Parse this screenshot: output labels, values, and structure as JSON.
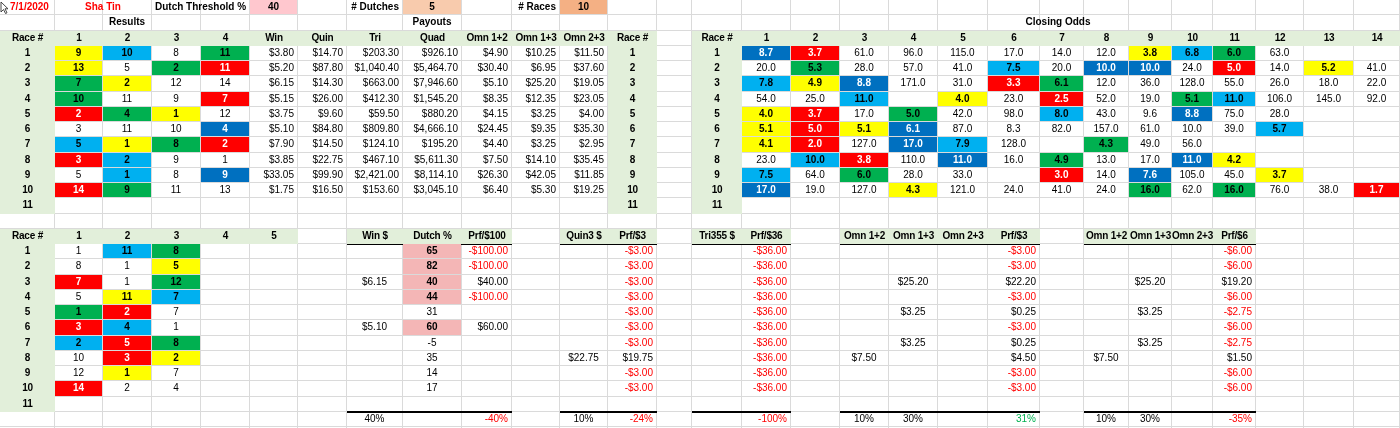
{
  "sheet": {
    "date": "7/1/2020",
    "track": "Sha Tin",
    "settings": [
      {
        "label": "Dutch Threshold %",
        "value": "40",
        "color": "#ffc7ce"
      },
      {
        "label": "# Dutches",
        "value": "5",
        "color": "#f8cbad"
      },
      {
        "label": "# Races",
        "value": "10",
        "color": "#f4b084"
      }
    ]
  },
  "results": {
    "title": "Results",
    "header": [
      "Race #",
      "1",
      "2",
      "3",
      "4"
    ],
    "races": [
      "1",
      "2",
      "3",
      "4",
      "5",
      "6",
      "7",
      "8",
      "9",
      "10",
      "11"
    ],
    "rows": [
      [
        {
          "text": "9",
          "color": "#ffff00"
        },
        {
          "text": "10",
          "color": "#00b0f0"
        },
        "8",
        {
          "text": "11",
          "color": "#00b050"
        }
      ],
      [
        {
          "text": "13",
          "color": "#ffff00"
        },
        "5",
        {
          "text": "2",
          "color": "#00b050"
        },
        {
          "text": "11",
          "color": "#ff0000"
        }
      ],
      [
        {
          "text": "7",
          "color": "#00b050"
        },
        {
          "text": "2",
          "color": "#ffff00"
        },
        "12",
        "14"
      ],
      [
        {
          "text": "10",
          "color": "#00b050"
        },
        "11",
        "9",
        {
          "text": "7",
          "color": "#ff0000"
        }
      ],
      [
        {
          "text": "2",
          "color": "#ff0000"
        },
        {
          "text": "4",
          "color": "#00b050"
        },
        {
          "text": "1",
          "color": "#ffff00"
        },
        "12"
      ],
      [
        "3",
        "11",
        "10",
        {
          "text": "4",
          "color": "#0070c0"
        }
      ],
      [
        {
          "text": "5",
          "color": "#00b0f0"
        },
        {
          "text": "1",
          "color": "#ffff00"
        },
        {
          "text": "8",
          "color": "#00b050"
        },
        {
          "text": "2",
          "color": "#ff0000"
        }
      ],
      [
        {
          "text": "3",
          "color": "#ff0000"
        },
        {
          "text": "2",
          "color": "#00b0f0"
        },
        "9",
        "1"
      ],
      [
        "5",
        {
          "text": "1",
          "color": "#00b0f0"
        },
        "8",
        {
          "text": "9",
          "color": "#0070c0"
        }
      ],
      [
        {
          "text": "14",
          "color": "#ff0000"
        },
        {
          "text": "9",
          "color": "#00b050"
        },
        "11",
        "13"
      ]
    ]
  },
  "payouts": {
    "title": "Payouts",
    "header": [
      "Win",
      "Quin",
      "Tri",
      "Quad",
      "Omn 1+2",
      "Omn 1+3",
      "Omn 2+3"
    ],
    "race_header": "Race #",
    "races": [
      "1",
      "2",
      "3",
      "4",
      "5",
      "6",
      "7",
      "8",
      "9",
      "10",
      "11"
    ],
    "rows": [
      [
        "$3.80",
        "$14.70",
        "$203.30",
        "$926.10",
        "$4.90",
        "$10.25",
        "$11.50"
      ],
      [
        "$5.20",
        "$87.80",
        "$1,040.40",
        "$5,464.70",
        "$30.40",
        "$6.95",
        "$37.60"
      ],
      [
        "$6.15",
        "$14.30",
        "$663.00",
        "$7,946.60",
        "$5.10",
        "$25.20",
        "$19.05"
      ],
      [
        "$5.15",
        "$26.00",
        "$412.30",
        "$1,545.20",
        "$8.35",
        "$12.35",
        "$23.05"
      ],
      [
        "$3.75",
        "$9.60",
        "$59.50",
        "$880.20",
        "$4.15",
        "$3.25",
        "$4.00"
      ],
      [
        "$5.10",
        "$84.80",
        "$809.80",
        "$4,666.10",
        "$24.45",
        "$9.35",
        "$35.30"
      ],
      [
        "$7.90",
        "$14.50",
        "$124.10",
        "$195.20",
        "$4.40",
        "$3.25",
        "$2.95"
      ],
      [
        "$3.85",
        "$22.75",
        "$467.10",
        "$5,611.30",
        "$7.50",
        "$14.10",
        "$35.45"
      ],
      [
        "$33.05",
        "$99.90",
        "$2,421.00",
        "$8,114.10",
        "$26.30",
        "$42.05",
        "$11.85"
      ],
      [
        "$1.75",
        "$16.50",
        "$153.60",
        "$3,045.10",
        "$6.40",
        "$5.30",
        "$19.25"
      ]
    ]
  },
  "closing_odds": {
    "title": "Closing Odds",
    "header": [
      "Race #",
      "1",
      "2",
      "3",
      "4",
      "5",
      "6",
      "7",
      "8",
      "9",
      "10",
      "11",
      "12",
      "13",
      "14"
    ],
    "races": [
      "1",
      "2",
      "3",
      "4",
      "5",
      "6",
      "7",
      "8",
      "9",
      "10",
      "11"
    ],
    "rows": [
      [
        {
          "text": "8.7",
          "color": "#0070c0"
        },
        {
          "text": "3.7",
          "color": "#ff0000"
        },
        "61.0",
        "96.0",
        "115.0",
        "17.0",
        "14.0",
        "12.0",
        {
          "text": "3.8",
          "color": "#ffff00"
        },
        {
          "text": "6.8",
          "color": "#00b0f0"
        },
        {
          "text": "6.0",
          "color": "#00b050"
        },
        "63.0",
        null,
        null
      ],
      [
        "20.0",
        {
          "text": "5.3",
          "color": "#00b050"
        },
        "28.0",
        "57.0",
        "41.0",
        {
          "text": "7.5",
          "color": "#00b0f0"
        },
        "20.0",
        {
          "text": "10.0",
          "color": "#0070c0"
        },
        {
          "text": "10.0",
          "color": "#0070c0"
        },
        "24.0",
        {
          "text": "5.0",
          "color": "#ff0000"
        },
        "14.0",
        {
          "text": "5.2",
          "color": "#ffff00"
        },
        "41.0"
      ],
      [
        {
          "text": "7.8",
          "color": "#00b0f0"
        },
        {
          "text": "4.9",
          "color": "#ffff00"
        },
        {
          "text": "8.8",
          "color": "#0070c0"
        },
        "171.0",
        "31.0",
        {
          "text": "3.3",
          "color": "#ff0000"
        },
        {
          "text": "6.1",
          "color": "#00b050"
        },
        "12.0",
        "36.0",
        "128.0",
        "55.0",
        "26.0",
        "18.0",
        "22.0"
      ],
      [
        "54.0",
        "25.0",
        {
          "text": "11.0",
          "color": "#00b0f0"
        },
        null,
        {
          "text": "4.0",
          "color": "#ffff00"
        },
        "23.0",
        {
          "text": "2.5",
          "color": "#ff0000"
        },
        "52.0",
        "19.0",
        {
          "text": "5.1",
          "color": "#00b050"
        },
        {
          "text": "11.0",
          "color": "#00b0f0"
        },
        "106.0",
        "145.0",
        "92.0"
      ],
      [
        {
          "text": "4.0",
          "color": "#ffff00"
        },
        {
          "text": "3.7",
          "color": "#ff0000"
        },
        "17.0",
        {
          "text": "5.0",
          "color": "#00b050"
        },
        "42.0",
        "98.0",
        {
          "text": "8.0",
          "color": "#00b0f0"
        },
        "43.0",
        "9.6",
        {
          "text": "8.8",
          "color": "#0070c0"
        },
        "75.0",
        "28.0",
        null,
        null
      ],
      [
        {
          "text": "5.1",
          "color": "#ffff00"
        },
        {
          "text": "5.0",
          "color": "#ff0000"
        },
        {
          "text": "5.1",
          "color": "#ffff00"
        },
        {
          "text": "6.1",
          "color": "#0070c0"
        },
        "87.0",
        "8.3",
        "82.0",
        "157.0",
        "61.0",
        "10.0",
        "39.0",
        {
          "text": "5.7",
          "color": "#00b0f0"
        },
        null,
        null
      ],
      [
        {
          "text": "4.1",
          "color": "#ffff00"
        },
        {
          "text": "2.0",
          "color": "#ff0000"
        },
        "127.0",
        {
          "text": "17.0",
          "color": "#0070c0"
        },
        {
          "text": "7.9",
          "color": "#00b0f0"
        },
        "128.0",
        null,
        {
          "text": "4.3",
          "color": "#00b050"
        },
        "49.0",
        "56.0",
        null,
        null,
        null,
        null
      ],
      [
        "23.0",
        {
          "text": "10.0",
          "color": "#00b0f0"
        },
        {
          "text": "3.8",
          "color": "#ff0000"
        },
        "110.0",
        {
          "text": "11.0",
          "color": "#0070c0"
        },
        "16.0",
        {
          "text": "4.9",
          "color": "#00b050"
        },
        "13.0",
        "17.0",
        {
          "text": "11.0",
          "color": "#0070c0"
        },
        {
          "text": "4.2",
          "color": "#ffff00"
        },
        null,
        null,
        null
      ],
      [
        {
          "text": "7.5",
          "color": "#00b0f0"
        },
        "64.0",
        {
          "text": "6.0",
          "color": "#00b050"
        },
        "28.0",
        "33.0",
        null,
        {
          "text": "3.0",
          "color": "#ff0000"
        },
        "14.0",
        {
          "text": "7.6",
          "color": "#0070c0"
        },
        "105.0",
        "45.0",
        {
          "text": "3.7",
          "color": "#ffff00"
        },
        null,
        null
      ],
      [
        {
          "text": "17.0",
          "color": "#0070c0"
        },
        "19.0",
        "127.0",
        {
          "text": "4.3",
          "color": "#ffff00"
        },
        "121.0",
        "24.0",
        "41.0",
        "24.0",
        {
          "text": "16.0",
          "color": "#00b050"
        },
        "62.0",
        {
          "text": "16.0",
          "color": "#00b050"
        },
        "76.0",
        "38.0",
        {
          "text": "1.7",
          "color": "#ff0000"
        }
      ]
    ]
  },
  "picks": {
    "header": [
      "Race #",
      "1",
      "2",
      "3",
      "4",
      "5"
    ],
    "races": [
      "1",
      "2",
      "3",
      "4",
      "5",
      "6",
      "7",
      "8",
      "9",
      "10",
      "11"
    ],
    "rows": [
      [
        "1",
        {
          "text": "11",
          "color": "#00b0f0"
        },
        {
          "text": "8",
          "color": "#00b050"
        }
      ],
      [
        "8",
        "1",
        {
          "text": "5",
          "color": "#ffff00"
        }
      ],
      [
        {
          "text": "7",
          "color": "#ff0000"
        },
        "1",
        {
          "text": "12",
          "color": "#00b050"
        }
      ],
      [
        "5",
        {
          "text": "11",
          "color": "#ffff00"
        },
        {
          "text": "7",
          "color": "#00b0f0"
        }
      ],
      [
        {
          "text": "1",
          "color": "#00b050"
        },
        {
          "text": "2",
          "color": "#ff0000"
        },
        "7"
      ],
      [
        {
          "text": "3",
          "color": "#ff0000"
        },
        {
          "text": "4",
          "color": "#00b0f0"
        },
        "1"
      ],
      [
        {
          "text": "2",
          "color": "#00b0f0"
        },
        {
          "text": "5",
          "color": "#ff0000"
        },
        {
          "text": "8",
          "color": "#00b050"
        }
      ],
      [
        "10",
        {
          "text": "3",
          "color": "#ff0000"
        },
        {
          "text": "2",
          "color": "#ffff00"
        }
      ],
      [
        "12",
        {
          "text": "1",
          "color": "#ffff00"
        },
        "7"
      ],
      [
        {
          "text": "14",
          "color": "#ff0000"
        },
        "2",
        "4"
      ]
    ]
  },
  "bets": [
    {
      "header": [
        "Win $",
        "Dutch %",
        "Prf/$100"
      ],
      "rows": [
        [
          null,
          {
            "text": "65",
            "highlighted": true
          },
          {
            "text": "-$100.00",
            "loss": true
          }
        ],
        [
          null,
          {
            "text": "82",
            "highlighted": true
          },
          {
            "text": "-$100.00",
            "loss": true
          }
        ],
        [
          "$6.15",
          {
            "text": "40",
            "highlighted": true
          },
          {
            "text": "$40.00",
            "loss": false
          }
        ],
        [
          null,
          {
            "text": "44",
            "highlighted": true
          },
          {
            "text": "-$100.00",
            "loss": true
          }
        ],
        [
          null,
          {
            "text": "31",
            "highlighted": false
          },
          null
        ],
        [
          "$5.10",
          {
            "text": "60",
            "highlighted": true
          },
          {
            "text": "$60.00",
            "loss": false
          }
        ],
        [
          null,
          {
            "text": "-5",
            "highlighted": false
          },
          null
        ],
        [
          null,
          {
            "text": "35",
            "highlighted": false
          },
          null
        ],
        [
          null,
          {
            "text": "14",
            "highlighted": false
          },
          null
        ],
        [
          null,
          {
            "text": "17",
            "highlighted": false
          },
          null
        ]
      ],
      "totals": {
        "column_1": "40%",
        "column_3": {
          "text": "-40%",
          "loss": true
        }
      }
    },
    {
      "header": [
        "Quin3 $",
        "Prf/$3"
      ],
      "rows": [
        [
          null,
          {
            "text": "-$3.00",
            "loss": true
          }
        ],
        [
          null,
          {
            "text": "-$3.00",
            "loss": true
          }
        ],
        [
          null,
          {
            "text": "-$3.00",
            "loss": true
          }
        ],
        [
          null,
          {
            "text": "-$3.00",
            "loss": true
          }
        ],
        [
          null,
          {
            "text": "-$3.00",
            "loss": true
          }
        ],
        [
          null,
          {
            "text": "-$3.00",
            "loss": true
          }
        ],
        [
          null,
          {
            "text": "-$3.00",
            "loss": true
          }
        ],
        [
          "$22.75",
          {
            "text": "$19.75",
            "loss": false
          }
        ],
        [
          null,
          {
            "text": "-$3.00",
            "loss": true
          }
        ],
        [
          null,
          {
            "text": "-$3.00",
            "loss": true
          }
        ]
      ],
      "totals": {
        "column_1": "10%",
        "column_2": {
          "text": "-24%",
          "loss": true
        }
      }
    },
    {
      "header": [
        "Tri355 $",
        "Prf/$36"
      ],
      "rows": [
        [
          null,
          {
            "text": "-$36.00",
            "loss": true
          }
        ],
        [
          null,
          {
            "text": "-$36.00",
            "loss": true
          }
        ],
        [
          null,
          {
            "text": "-$36.00",
            "loss": true
          }
        ],
        [
          null,
          {
            "text": "-$36.00",
            "loss": true
          }
        ],
        [
          null,
          {
            "text": "-$36.00",
            "loss": true
          }
        ],
        [
          null,
          {
            "text": "-$36.00",
            "loss": true
          }
        ],
        [
          null,
          {
            "text": "-$36.00",
            "loss": true
          }
        ],
        [
          null,
          {
            "text": "-$36.00",
            "loss": true
          }
        ],
        [
          null,
          {
            "text": "-$36.00",
            "loss": true
          }
        ],
        [
          null,
          {
            "text": "-$36.00",
            "loss": true
          }
        ]
      ],
      "totals": {
        "column_2": {
          "text": "-100%",
          "loss": true
        }
      }
    },
    {
      "header": [
        "Omn 1+2",
        "Omn 1+3",
        "Omn 2+3",
        "Prf/$3"
      ],
      "rows": [
        [
          null,
          null,
          null,
          {
            "text": "-$3.00",
            "loss": true
          }
        ],
        [
          null,
          null,
          null,
          {
            "text": "-$3.00",
            "loss": true
          }
        ],
        [
          null,
          "$25.20",
          null,
          {
            "text": "$22.20",
            "loss": false
          }
        ],
        [
          null,
          null,
          null,
          {
            "text": "-$3.00",
            "loss": true
          }
        ],
        [
          null,
          "$3.25",
          null,
          {
            "text": "$0.25",
            "loss": false
          }
        ],
        [
          null,
          null,
          null,
          {
            "text": "-$3.00",
            "loss": true
          }
        ],
        [
          null,
          "$3.25",
          null,
          {
            "text": "$0.25",
            "loss": false
          }
        ],
        [
          "$7.50",
          null,
          null,
          {
            "text": "$4.50",
            "loss": false
          }
        ],
        [
          null,
          null,
          null,
          {
            "text": "-$3.00",
            "loss": true
          }
        ],
        [
          null,
          null,
          null,
          {
            "text": "-$3.00",
            "loss": true
          }
        ]
      ],
      "totals": {
        "column_1": "10%",
        "column_2": "30%",
        "column_4": {
          "text": "31%",
          "loss": false
        }
      }
    },
    {
      "header": [
        "Omn 1+2",
        "Omn 1+3",
        "Omn 2+3",
        "Prf/$6"
      ],
      "rows": [
        [
          null,
          null,
          null,
          {
            "text": "-$6.00",
            "loss": true
          }
        ],
        [
          null,
          null,
          null,
          {
            "text": "-$6.00",
            "loss": true
          }
        ],
        [
          null,
          "$25.20",
          null,
          {
            "text": "$19.20",
            "loss": false
          }
        ],
        [
          null,
          null,
          null,
          {
            "text": "-$6.00",
            "loss": true
          }
        ],
        [
          null,
          "$3.25",
          null,
          {
            "text": "-$2.75",
            "loss": true
          }
        ],
        [
          null,
          null,
          null,
          {
            "text": "-$6.00",
            "loss": true
          }
        ],
        [
          null,
          "$3.25",
          null,
          {
            "text": "-$2.75",
            "loss": true
          }
        ],
        [
          "$7.50",
          null,
          null,
          {
            "text": "$1.50",
            "loss": false
          }
        ],
        [
          null,
          null,
          null,
          {
            "text": "-$6.00",
            "loss": true
          }
        ],
        [
          null,
          null,
          null,
          {
            "text": "-$6.00",
            "loss": true
          }
        ]
      ],
      "totals": {
        "column_1": "10%",
        "column_2": "30%",
        "column_4": {
          "text": "-35%",
          "loss": true
        }
      }
    }
  ]
}
